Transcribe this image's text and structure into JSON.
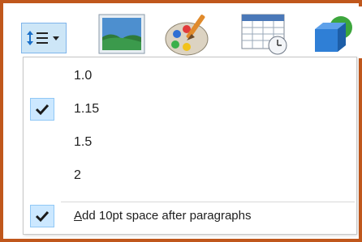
{
  "ribbon": {
    "spacing_button_icon": "line-spacing-icon",
    "icons": [
      "picture-icon",
      "paint-palette-icon",
      "date-time-icon",
      "insert-object-icon"
    ]
  },
  "menu": {
    "items": [
      {
        "label": "1.0",
        "checked": false
      },
      {
        "label": "1.15",
        "checked": true
      },
      {
        "label": "1.5",
        "checked": false
      },
      {
        "label": "2",
        "checked": false
      },
      {
        "label": "Add 10pt space after paragraphs",
        "checked": true
      }
    ]
  },
  "colors": {
    "frame_border": "#c0571c",
    "highlight": "#cce8ff"
  }
}
